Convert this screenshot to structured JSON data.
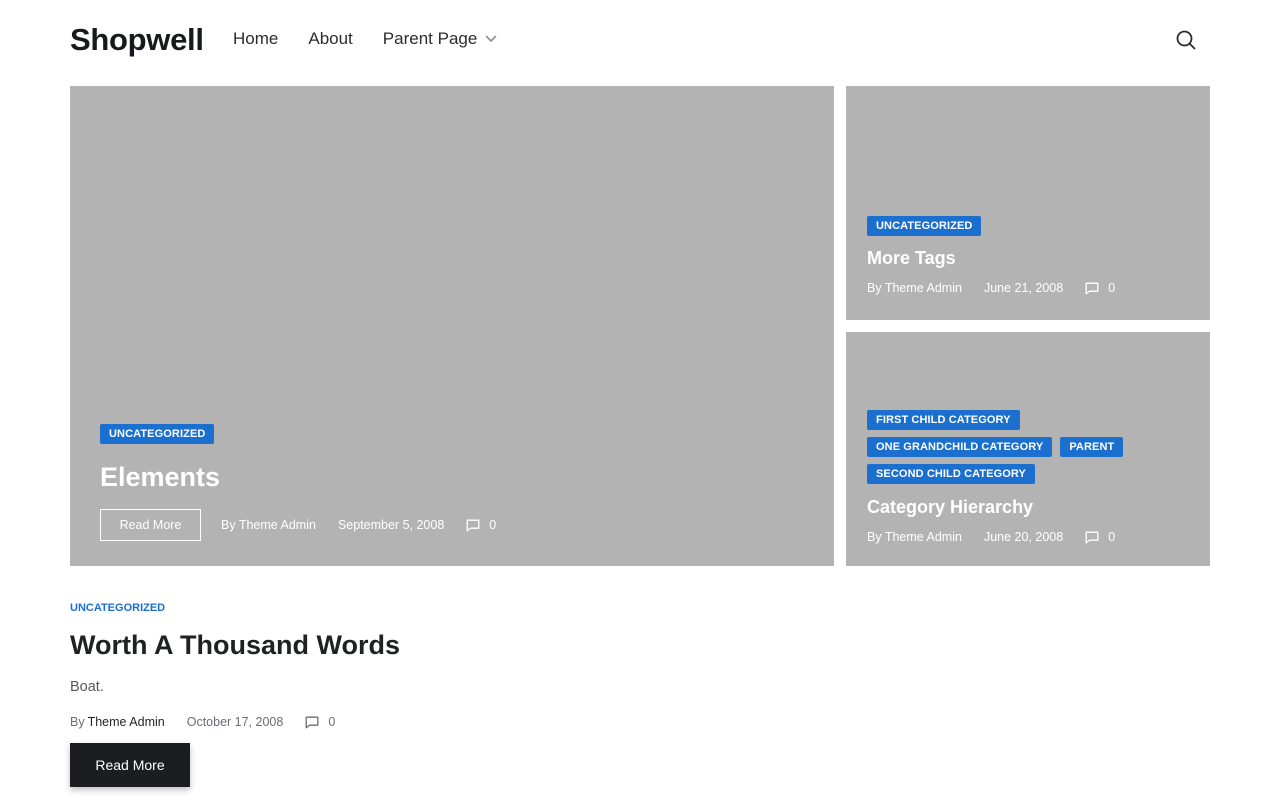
{
  "site": {
    "logo": "Shopwell"
  },
  "nav": {
    "items": [
      {
        "label": "Home"
      },
      {
        "label": "About"
      },
      {
        "label": "Parent Page",
        "has_dropdown": true
      }
    ],
    "search_icon": "search-icon"
  },
  "featured": {
    "main": {
      "category": "UNCATEGORIZED",
      "title": "Elements",
      "read_more": "Read More",
      "author": "By Theme Admin",
      "date": "September 5, 2008",
      "comments": "0"
    },
    "top": {
      "category": "UNCATEGORIZED",
      "title": "More Tags",
      "author": "By Theme Admin",
      "date": "June 21, 2008",
      "comments": "0"
    },
    "bottom": {
      "categories": [
        "FIRST CHILD CATEGORY",
        "ONE GRANDCHILD CATEGORY",
        "PARENT",
        "SECOND CHILD CATEGORY"
      ],
      "title": "Category Hierarchy",
      "author": "By Theme Admin",
      "date": "June 20, 2008",
      "comments": "0"
    }
  },
  "post": {
    "category": "UNCATEGORIZED",
    "title": "Worth A Thousand Words",
    "excerpt": "Boat.",
    "by": "By",
    "author": "Theme Admin",
    "date": "October 17, 2008",
    "comments": "0",
    "read_more": "Read More"
  },
  "colors": {
    "accent": "#1a6fcf",
    "image_placeholder": "#b3b3b3",
    "button_dark": "#1b1d20"
  }
}
